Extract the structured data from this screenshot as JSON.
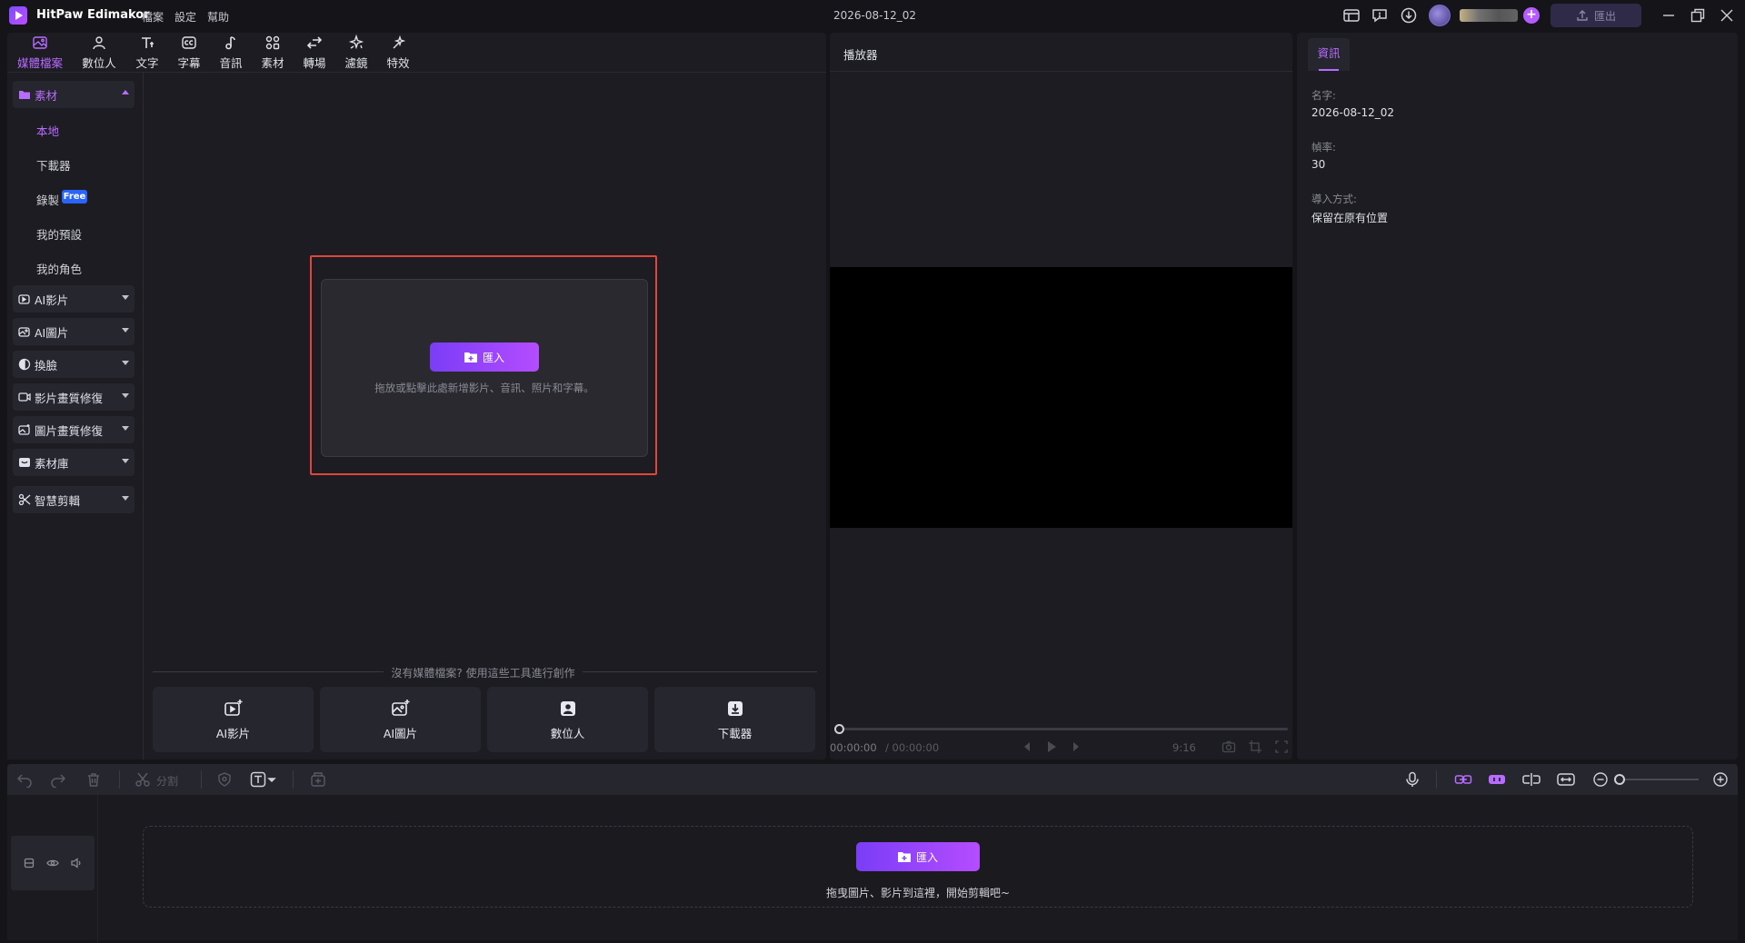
{
  "app": {
    "title": "HitPaw Edimakor",
    "project_name": "2026-08-12_02"
  },
  "menu": [
    "檔案",
    "設定",
    "幫助"
  ],
  "titlebar": {
    "icons": [
      "layout-icon",
      "feedback-icon",
      "download-icon"
    ],
    "export_label": "匯出"
  },
  "tabs": [
    {
      "label": "媒體檔案",
      "icon": "media-icon"
    },
    {
      "label": "數位人",
      "icon": "digital-human-icon"
    },
    {
      "label": "文字",
      "icon": "text-icon"
    },
    {
      "label": "字幕",
      "icon": "subtitle-icon"
    },
    {
      "label": "音訊",
      "icon": "audio-icon"
    },
    {
      "label": "素材",
      "icon": "assets-icon"
    },
    {
      "label": "轉場",
      "icon": "transition-icon"
    },
    {
      "label": "濾鏡",
      "icon": "filter-icon"
    },
    {
      "label": "特效",
      "icon": "effects-icon"
    }
  ],
  "sidebar": {
    "sections": [
      {
        "label": "素材",
        "icon": "folder-icon",
        "expanded": true
      },
      {
        "label": "AI影片",
        "icon": "ai-video-icon"
      },
      {
        "label": "AI圖片",
        "icon": "ai-image-icon"
      },
      {
        "label": "換臉",
        "icon": "face-swap-icon"
      },
      {
        "label": "影片畫質修復",
        "icon": "video-enhance-icon"
      },
      {
        "label": "圖片畫質修復",
        "icon": "image-enhance-icon"
      },
      {
        "label": "素材庫",
        "icon": "library-icon"
      },
      {
        "label": "智慧剪輯",
        "icon": "smart-cut-icon"
      }
    ],
    "sub_items": [
      "本地",
      "下載器",
      "錄製",
      "我的預設",
      "我的角色"
    ],
    "free_badge": "Free"
  },
  "drop_zone": {
    "import_label": "匯入",
    "hint": "拖放或點擊此處新增影片、音訊、照片和字幕。"
  },
  "tools": {
    "caption": "沒有媒體檔案? 使用這些工具進行創作",
    "cards": [
      {
        "label": "AI影片",
        "icon": "ai-video-icon"
      },
      {
        "label": "AI圖片",
        "icon": "ai-image-icon"
      },
      {
        "label": "數位人",
        "icon": "digital-human-icon"
      },
      {
        "label": "下載器",
        "icon": "downloader-icon"
      }
    ]
  },
  "player": {
    "title": "播放器",
    "time_current": "00:00:00",
    "time_total": "/ 00:00:00",
    "aspect": "9:16",
    "progress": 0
  },
  "info": {
    "tab": "資訊",
    "fields": [
      {
        "label": "名字:",
        "value": "2026-08-12_02"
      },
      {
        "label": "幀率:",
        "value": "30"
      },
      {
        "label": "導入方式:",
        "value": "保留在原有位置"
      }
    ]
  },
  "timeline": {
    "split_label": "分割",
    "import_label": "匯入",
    "hint": "拖曳圖片、影片到這裡，開始剪輯吧~",
    "zoom": 0
  },
  "colors": {
    "accent": "#b86cff",
    "highlight": "#e2453c",
    "button_gradient": [
      "#7a3df6",
      "#b54cff"
    ]
  }
}
